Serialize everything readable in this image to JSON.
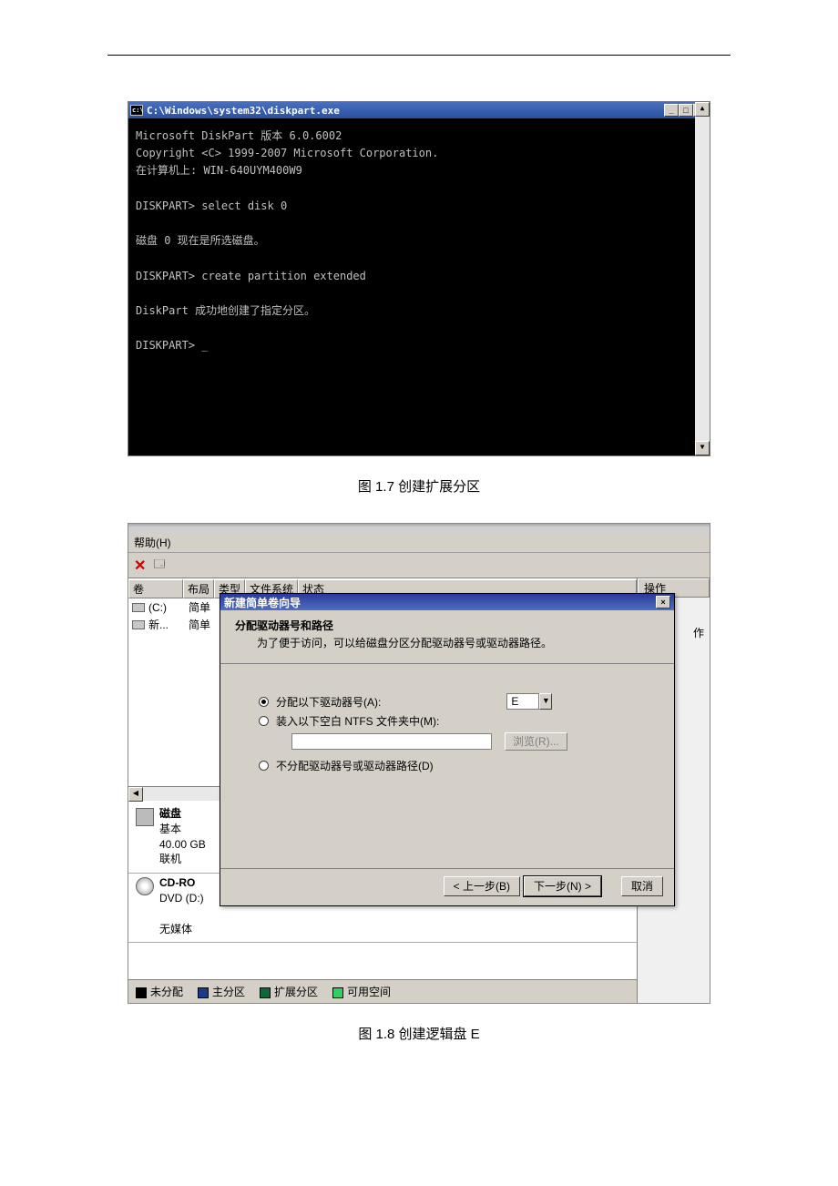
{
  "figure17": {
    "title": "C:\\Windows\\system32\\diskpart.exe",
    "lines": [
      "Microsoft DiskPart 版本 6.0.6002",
      "Copyright <C> 1999-2007 Microsoft Corporation.",
      "在计算机上: WIN-640UYM400W9",
      "",
      "DISKPART> select disk 0",
      "",
      "磁盘 0 现在是所选磁盘。",
      "",
      "DISKPART> create partition extended",
      "",
      "DiskPart 成功地创建了指定分区。",
      "",
      "DISKPART> _"
    ],
    "caption": "图 1.7  创建扩展分区"
  },
  "figure18": {
    "dm": {
      "menu_help": "帮助(H)",
      "col_vol": "卷",
      "col_layout": "布局",
      "col_type": "类型",
      "col_fs": "文件系统",
      "col_status": "状态",
      "col_action": "操作",
      "row_c": "(C:)",
      "row_c_layout": "简单",
      "row_new": "新...",
      "row_new_layout": "简单",
      "right_action_sub": "作",
      "disk0": {
        "label": "磁盘",
        "type": "基本",
        "size": "40.00 GB",
        "status": "联机"
      },
      "cd": {
        "label": "CD-RO",
        "dev": "DVD (D:)",
        "media": "无媒体"
      },
      "legend": {
        "unalloc": "未分配",
        "primary": "主分区",
        "extended": "扩展分区",
        "free": "可用空间"
      },
      "colors": {
        "unalloc": "#000000",
        "primary": "#1a3a8a",
        "extended": "#0a6a3a",
        "free": "#30d060"
      }
    },
    "wizard": {
      "title": "新建简单卷向导",
      "h1": "分配驱动器号和路径",
      "h2": "为了便于访问，可以给磁盘分区分配驱动器号或驱动器路径。",
      "opt1": "分配以下驱动器号(A):",
      "opt2": "装入以下空白 NTFS 文件夹中(M):",
      "opt3": "不分配驱动器号或驱动器路径(D)",
      "drive_letter": "E",
      "browse": "浏览(R)...",
      "back": "< 上一步(B)",
      "next": "下一步(N) >",
      "cancel": "取消"
    },
    "caption": "图 1.8  创建逻辑盘 E"
  }
}
